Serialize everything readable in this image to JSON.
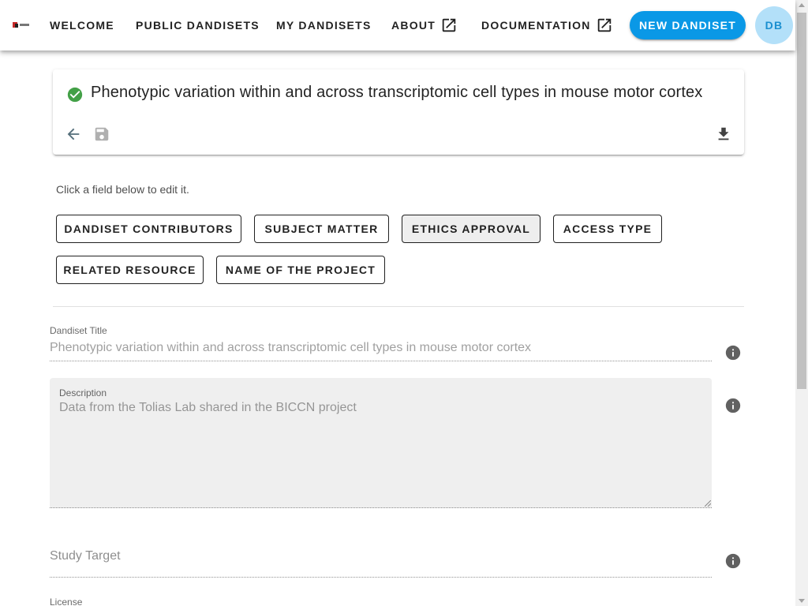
{
  "nav": {
    "items": [
      {
        "label": "Welcome"
      },
      {
        "label": "Public Dandisets"
      },
      {
        "label": "My Dandisets"
      },
      {
        "label": "About"
      },
      {
        "label": "Documentation"
      }
    ],
    "new_button": "New Dandiset",
    "avatar_initials": "DB"
  },
  "card": {
    "title": "Phenotypic variation within and across transcriptomic cell types in mouse motor cortex"
  },
  "hint": "Click a field below to edit it.",
  "field_buttons": [
    {
      "label": "Dandiset Contributors"
    },
    {
      "label": "Subject Matter"
    },
    {
      "label": "Ethics Approval"
    },
    {
      "label": "Access Type"
    },
    {
      "label": "Related Resource"
    },
    {
      "label": "Name of the Project"
    }
  ],
  "form": {
    "title_label": "Dandiset Title",
    "title_value": "Phenotypic variation within and across transcriptomic cell types in mouse motor cortex",
    "description_label": "Description",
    "description_value": "Data from the Tolias Lab shared in the BICCN project",
    "study_target_placeholder": "Study Target",
    "license_label": "License"
  },
  "colors": {
    "accent": "#0a98e6",
    "success": "#43a047",
    "icon_grey": "#546e7a"
  }
}
